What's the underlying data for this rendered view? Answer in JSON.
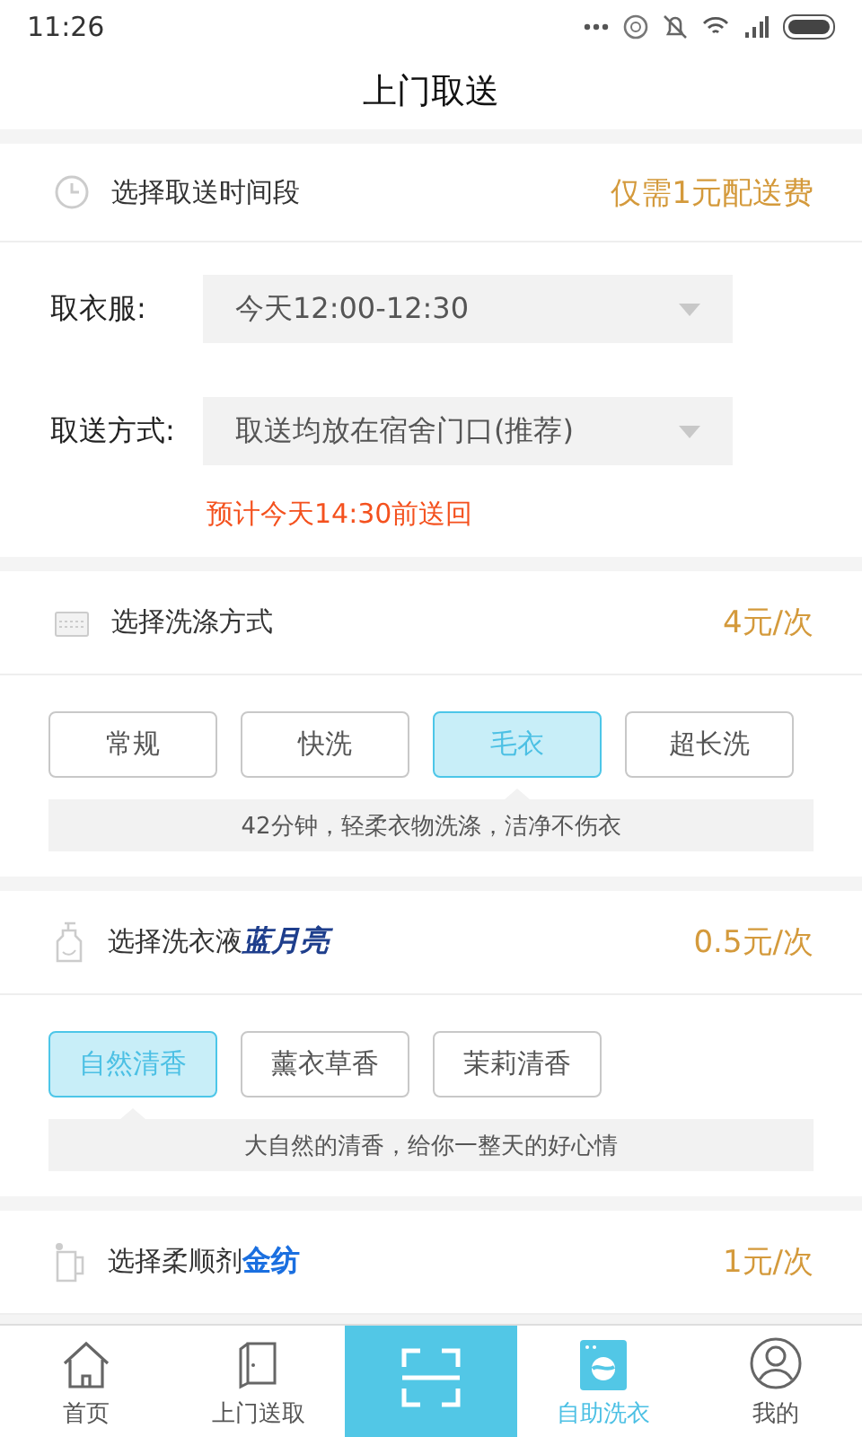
{
  "status_bar": {
    "time": "11:26"
  },
  "header": {
    "title": "上门取送"
  },
  "time_section": {
    "title": "选择取送时间段",
    "price": "仅需1元配送费",
    "fields": [
      {
        "label": "取衣服:",
        "value": "今天12:00-12:30"
      },
      {
        "label": "取送方式:",
        "value": "取送均放在宿舍门口(推荐)"
      }
    ],
    "estimate": "预计今天14:30前送回"
  },
  "option_sections": [
    {
      "kind": "wash",
      "title": "选择洗涤方式",
      "price": "4元/次",
      "options": [
        {
          "label": "常规",
          "selected": false
        },
        {
          "label": "快洗",
          "selected": false
        },
        {
          "label": "毛衣",
          "selected": true
        },
        {
          "label": "超长洗",
          "selected": false
        }
      ],
      "description": "42分钟，轻柔衣物洗涤，洁净不伤衣"
    },
    {
      "kind": "detergent",
      "title": "选择洗衣液",
      "brand": "蓝月亮",
      "price": "0.5元/次",
      "options": [
        {
          "label": "自然清香",
          "selected": true
        },
        {
          "label": "薰衣草香",
          "selected": false
        },
        {
          "label": "茉莉清香",
          "selected": false
        }
      ],
      "description": "大自然的清香，给你一整天的好心情"
    },
    {
      "kind": "softener",
      "title": "选择柔顺剂",
      "brand": "金纺",
      "price": "1元/次"
    }
  ],
  "tab_bar": [
    {
      "kind": "home",
      "label": "首页",
      "selected": false
    },
    {
      "kind": "door",
      "label": "上门送取",
      "selected": false
    },
    {
      "kind": "scan",
      "selected": false
    },
    {
      "kind": "washer",
      "label": "自助洗衣",
      "selected": true
    },
    {
      "kind": "profile",
      "label": "我的",
      "selected": false
    }
  ]
}
